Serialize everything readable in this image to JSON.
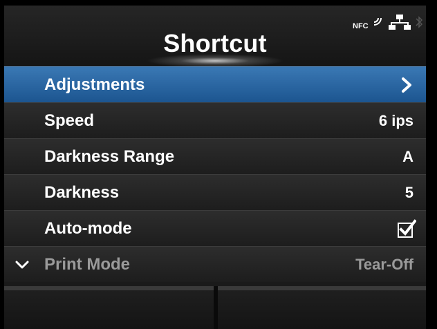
{
  "header": {
    "title": "Shortcut",
    "status_icons": [
      "nfc-icon",
      "network-icon",
      "bluetooth-icon"
    ],
    "nfc_label": "NFC"
  },
  "menu": {
    "items": [
      {
        "label": "Adjustments",
        "value": "",
        "icon": "chevron-right-icon",
        "selected": true
      },
      {
        "label": "Speed",
        "value": "6 ips"
      },
      {
        "label": "Darkness Range",
        "value": "A"
      },
      {
        "label": "Darkness",
        "value": "5"
      },
      {
        "label": "Auto-mode",
        "value": "",
        "icon": "checkbox-checked-icon"
      },
      {
        "label": "Print Mode",
        "value": "Tear-Off",
        "left_icon": "chevron-down-icon",
        "dimmed": true
      }
    ]
  },
  "colors": {
    "selected_row": "#2b6aa6",
    "row_background": "#262626",
    "text": "#ffffff",
    "dim_text": "#9a9a9a"
  },
  "soft_keys": {
    "left_label": "",
    "right_label": ""
  }
}
